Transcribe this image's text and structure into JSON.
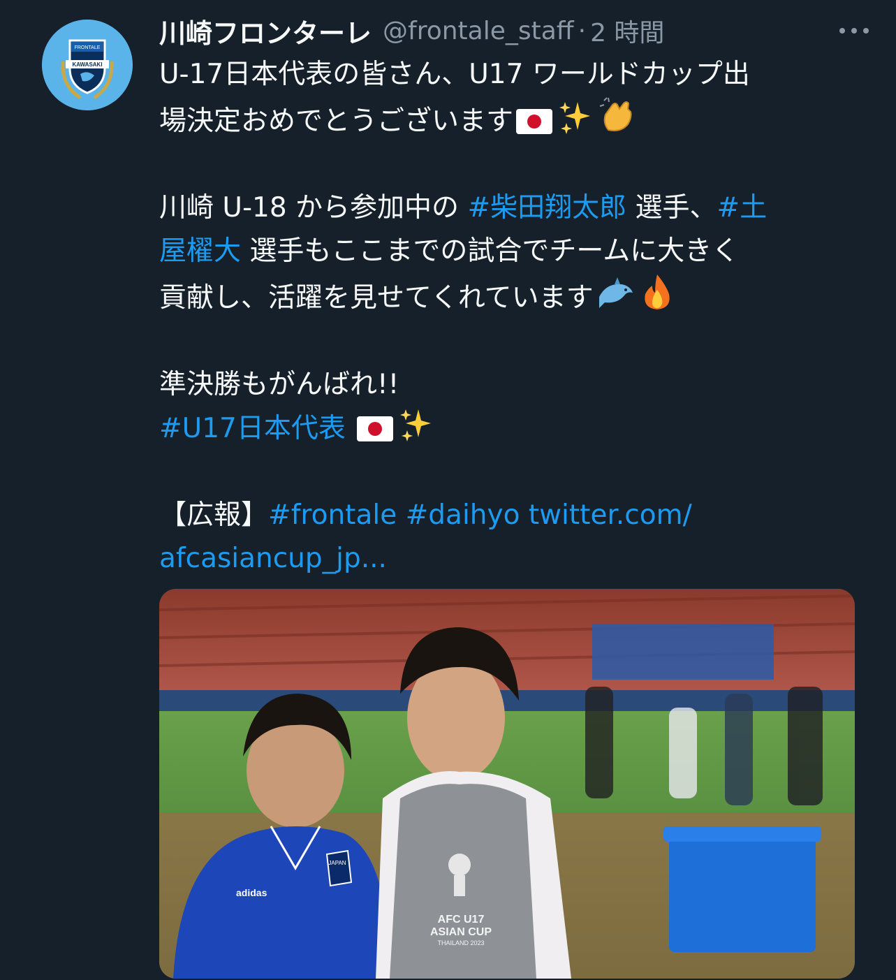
{
  "tweet": {
    "author_name": "川崎フロンターレ",
    "handle": "@frontale_staff",
    "separator": "·",
    "time": "2 時間",
    "more_icon": "more-horizontal-icon",
    "avatar_logo_text": {
      "top": "FRONTALE",
      "band": "KAWASAKI"
    },
    "lines": {
      "l1": "U-17日本代表の皆さん、U17 ワールドカップ出",
      "l2": "場決定おめでとうございます",
      "l3a": "川崎 U-18 から参加中の ",
      "l3tag": "#柴田翔太郎",
      "l3b": " 選手、",
      "l3tag2": "#土",
      "l4tag": "屋櫂大",
      "l4b": " 選手もここまでの試合でチームに大きく",
      "l5": "貢献し、活躍を見せてくれています",
      "l6": "準決勝もがんばれ!!",
      "l7tag": "#U17日本代表",
      "l8a": "【広報】",
      "l8tag1": "#frontale",
      "l8tag2": "#daihyo",
      "l8link": "twitter.com/",
      "l9link": "afcasiancup_jp..."
    },
    "photo": {
      "shirt_text_1": "AFC U17",
      "shirt_text_2": "ASIAN CUP",
      "shirt_text_3": "THAILAND 2023",
      "jacket_brand": "adidas",
      "crest_text": "JAPAN"
    }
  },
  "colors": {
    "background": "#15202b",
    "text": "#f7f9f9",
    "secondary": "#8b98a5",
    "link": "#1d9bf0",
    "avatar_bg": "#5ab4ea"
  }
}
